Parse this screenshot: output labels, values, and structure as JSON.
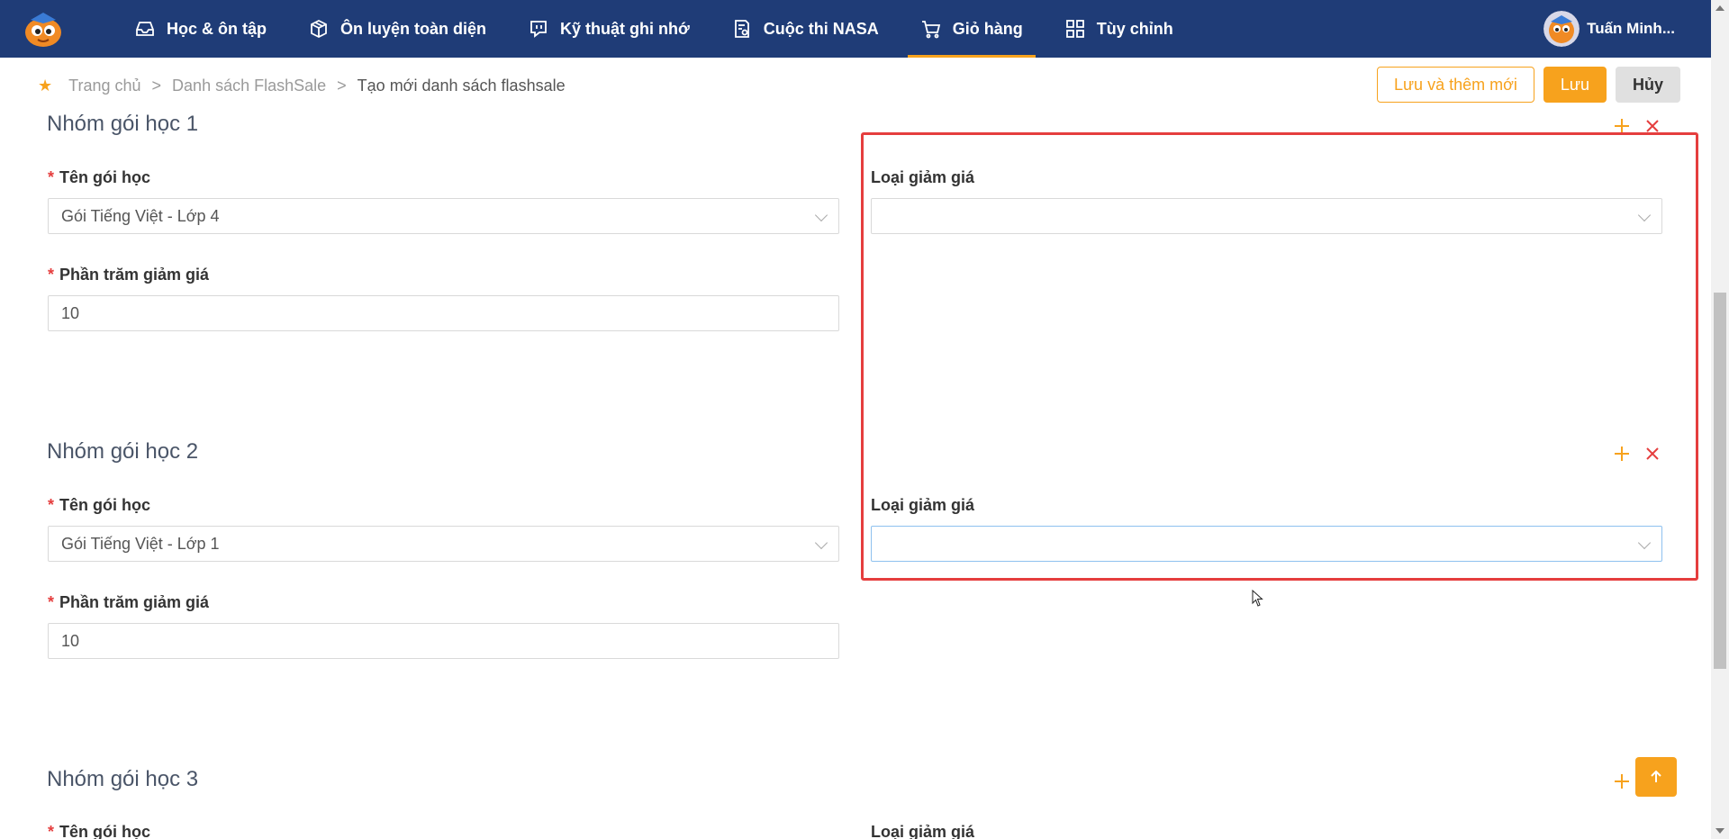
{
  "nav": {
    "items": [
      {
        "label": "Học & ôn tập",
        "icon": "inbox-icon"
      },
      {
        "label": "Ôn luyện toàn diện",
        "icon": "cube-icon"
      },
      {
        "label": "Kỹ thuật ghi nhớ",
        "icon": "chat-icon"
      },
      {
        "label": "Cuộc thi NASA",
        "icon": "document-icon"
      },
      {
        "label": "Giỏ hàng",
        "icon": "cart-icon",
        "active": true
      },
      {
        "label": "Tùy chỉnh",
        "icon": "grid-icon"
      }
    ],
    "user_name": "Tuấn Minh..."
  },
  "breadcrumb": {
    "home": "Trang chủ",
    "list": "Danh sách FlashSale",
    "current": "Tạo mới danh sách flashsale",
    "separator": ">"
  },
  "actions": {
    "save_and_new": "Lưu và thêm mới",
    "save": "Lưu",
    "cancel": "Hủy"
  },
  "groups": [
    {
      "title": "Nhóm gói học 1",
      "course_label": "Tên gói học",
      "course_value": "Gói Tiếng Việt - Lớp 4",
      "discount_type_label": "Loại giảm giá",
      "discount_type_value": "",
      "percent_label": "Phần trăm giảm giá",
      "percent_value": "10"
    },
    {
      "title": "Nhóm gói học 2",
      "course_label": "Tên gói học",
      "course_value": "Gói Tiếng Việt - Lớp 1",
      "discount_type_label": "Loại giảm giá",
      "discount_type_value": "",
      "percent_label": "Phần trăm giảm giá",
      "percent_value": "10"
    },
    {
      "title": "Nhóm gói học 3",
      "course_label": "Tên gói học",
      "discount_type_label": "Loại giảm giá"
    }
  ],
  "colors": {
    "navbar": "#1f3c77",
    "accent": "#f7a21d",
    "danger": "#e53e3e"
  }
}
